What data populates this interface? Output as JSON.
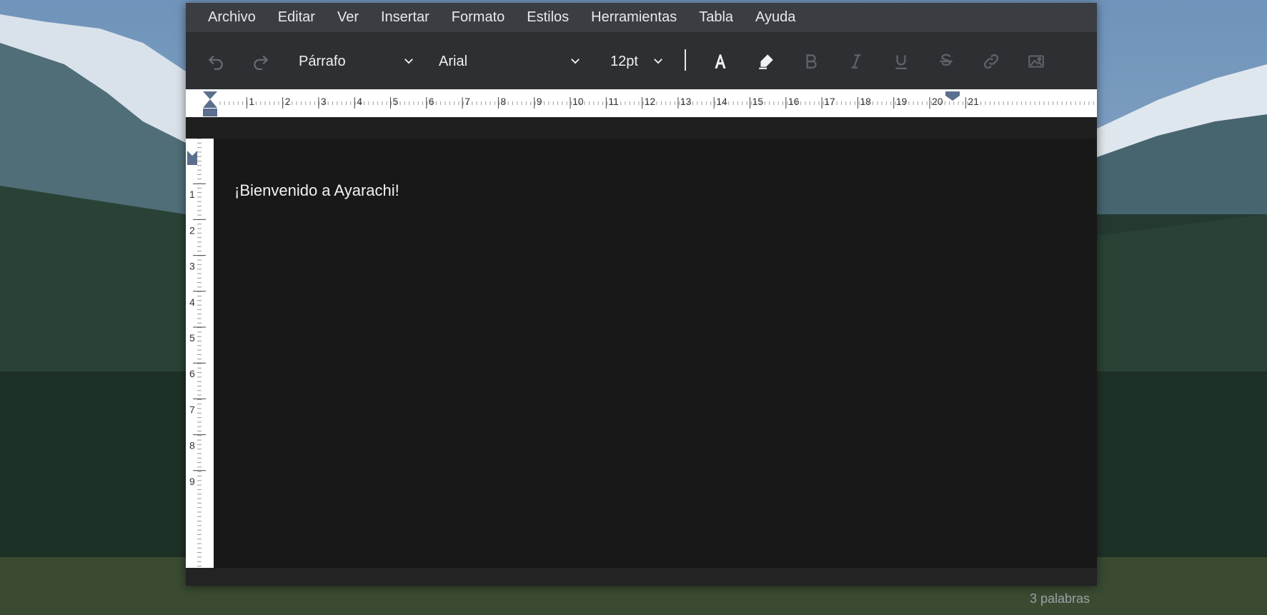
{
  "menu": [
    "Archivo",
    "Editar",
    "Ver",
    "Insertar",
    "Formato",
    "Estilos",
    "Herramientas",
    "Tabla",
    "Ayuda"
  ],
  "toolbar": {
    "block_format": "Párrafo",
    "font_family": "Arial",
    "font_size": "12pt",
    "icons": [
      "undo-icon",
      "redo-icon",
      "text-color-icon",
      "highlight-icon",
      "bold-icon",
      "italic-icon",
      "underline-icon",
      "strikethrough-icon",
      "link-icon",
      "image-icon"
    ]
  },
  "hruler": {
    "labels": [
      "1",
      "2",
      "3",
      "4",
      "5",
      "6",
      "7",
      "8",
      "9",
      "10",
      "11",
      "12",
      "13",
      "14",
      "15",
      "16",
      "17",
      "18",
      "19",
      "20",
      "21"
    ]
  },
  "vruler": {
    "labels": [
      "1",
      "2",
      "3",
      "4",
      "5",
      "6",
      "7",
      "8",
      "9"
    ]
  },
  "document": {
    "text": "¡Bienvenido a Ayarachi!"
  },
  "status": {
    "word_count": "3 palabras"
  },
  "colors": {
    "menubar": "#3a3d42",
    "toolbar": "#2d2f33",
    "editor": "#181818",
    "ruler_marker": "#5b6f8e"
  }
}
